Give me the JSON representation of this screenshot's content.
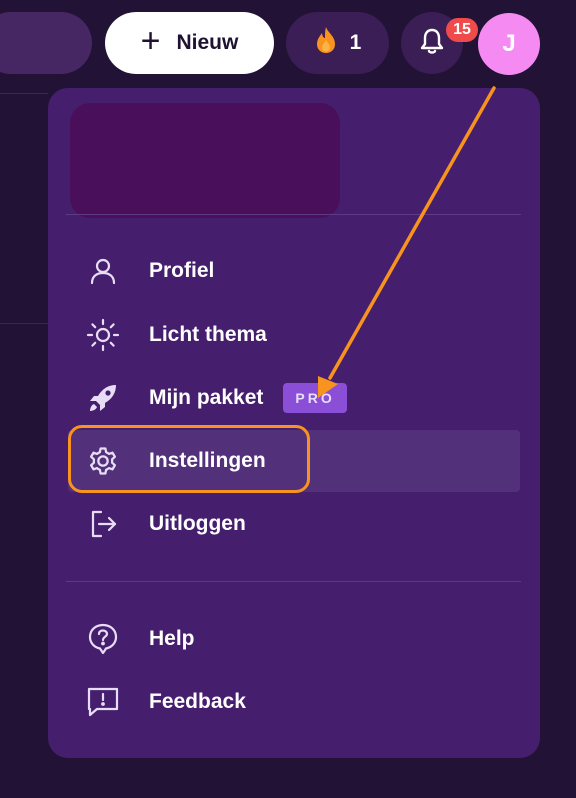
{
  "header": {
    "new_button_label": "Nieuw",
    "streak_count": "1",
    "notification_count": "15",
    "avatar_initial": "J"
  },
  "menu": {
    "items": [
      {
        "label": "Profiel",
        "icon": "user-icon"
      },
      {
        "label": "Licht thema",
        "icon": "sun-icon"
      },
      {
        "label": "Mijn pakket",
        "icon": "rocket-icon",
        "badge": "PRO"
      },
      {
        "label": "Instellingen",
        "icon": "gear-icon"
      },
      {
        "label": "Uitloggen",
        "icon": "logout-icon"
      },
      {
        "label": "Help",
        "icon": "help-icon"
      },
      {
        "label": "Feedback",
        "icon": "feedback-icon"
      }
    ]
  },
  "colors": {
    "background": "#221235",
    "menu_background": "#461e6e",
    "accent_orange": "#f7931e",
    "pro_badge": "#8a4fd6",
    "avatar": "#f58af2",
    "notification_badge": "#ef4b4b"
  }
}
